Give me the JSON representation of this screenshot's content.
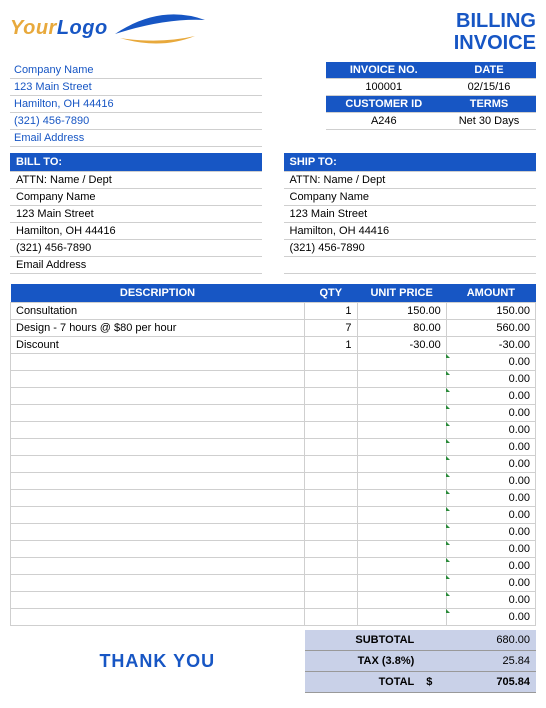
{
  "title": {
    "line1": "BILLING",
    "line2": "INVOICE"
  },
  "logo": {
    "word1": "Your",
    "word2": "Logo"
  },
  "company": {
    "name": "Company Name",
    "street": "123 Main Street",
    "citystate": "Hamilton, OH  44416",
    "phone": "(321) 456-7890",
    "email": "Email Address"
  },
  "meta": {
    "invoice_no_hdr": "INVOICE NO.",
    "date_hdr": "DATE",
    "invoice_no": "100001",
    "date": "02/15/16",
    "customer_id_hdr": "CUSTOMER ID",
    "terms_hdr": "TERMS",
    "customer_id": "A246",
    "terms": "Net 30 Days"
  },
  "bill_to_hdr": "BILL TO:",
  "ship_to_hdr": "SHIP TO:",
  "bill_to": {
    "attn": "ATTN: Name / Dept",
    "company": "Company Name",
    "street": "123 Main Street",
    "citystate": "Hamilton, OH  44416",
    "phone": "(321) 456-7890",
    "email": "Email Address"
  },
  "ship_to": {
    "attn": "ATTN: Name / Dept",
    "company": "Company Name",
    "street": "123 Main Street",
    "citystate": "Hamilton, OH  44416",
    "phone": "(321) 456-7890"
  },
  "cols": {
    "desc": "DESCRIPTION",
    "qty": "QTY",
    "up": "UNIT PRICE",
    "amt": "AMOUNT"
  },
  "items": [
    {
      "desc": "Consultation",
      "qty": "1",
      "up": "150.00",
      "amt": "150.00"
    },
    {
      "desc": "Design - 7 hours @ $80 per hour",
      "qty": "7",
      "up": "80.00",
      "amt": "560.00"
    },
    {
      "desc": "Discount",
      "qty": "1",
      "up": "-30.00",
      "amt": "-30.00"
    }
  ],
  "empty_amt": "0.00",
  "empty_rows": 16,
  "totals": {
    "subtotal_lbl": "SUBTOTAL",
    "subtotal": "680.00",
    "tax_lbl": "TAX (3.8%)",
    "tax": "25.84",
    "total_lbl": "TOTAL",
    "currency": "$",
    "total": "705.84"
  },
  "thanks": "THANK YOU"
}
